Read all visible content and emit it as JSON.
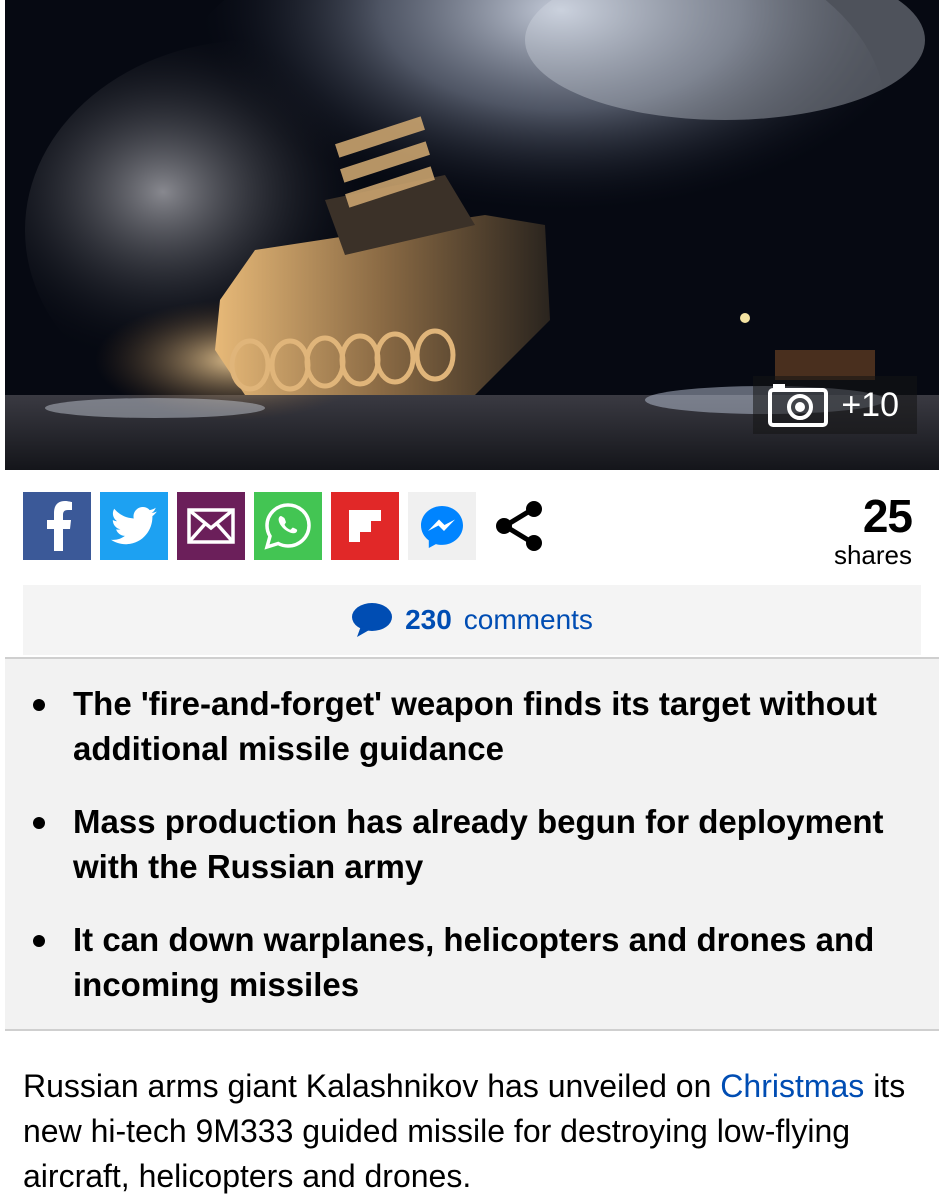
{
  "hero": {
    "gallery_count": "+10",
    "icons": {
      "camera": "camera-icon"
    }
  },
  "share": {
    "buttons": [
      {
        "name": "facebook",
        "icon": "facebook-icon",
        "color": "#3b5998"
      },
      {
        "name": "twitter",
        "icon": "twitter-icon",
        "color": "#1da1f2"
      },
      {
        "name": "email",
        "icon": "email-icon",
        "color": "#6b1f5a"
      },
      {
        "name": "whatsapp",
        "icon": "whatsapp-icon",
        "color": "#43c553"
      },
      {
        "name": "flipboard",
        "icon": "flipboard-icon",
        "color": "#e12828"
      },
      {
        "name": "messenger",
        "icon": "messenger-icon",
        "color": "#0084ff"
      },
      {
        "name": "share",
        "icon": "share-icon",
        "color": "#000000"
      }
    ],
    "count": "25",
    "count_label": "shares"
  },
  "comments": {
    "count": "230",
    "label": "comments",
    "icon": "speech-bubble-icon",
    "color": "#004db3"
  },
  "bullets": [
    "The 'fire-and-forget' weapon finds its target without additional missile guidance",
    "Mass production has already begun for deployment with the Russian army",
    "It can down warplanes, helicopters and drones and incoming missiles"
  ],
  "article": {
    "part1": "Russian arms giant Kalashnikov has unveiled on ",
    "link": "Christmas",
    "part2": " its new hi-tech 9M333 guided missile for destroying low-flying aircraft, helicopters and drones.",
    "link_color": "#004db3"
  }
}
